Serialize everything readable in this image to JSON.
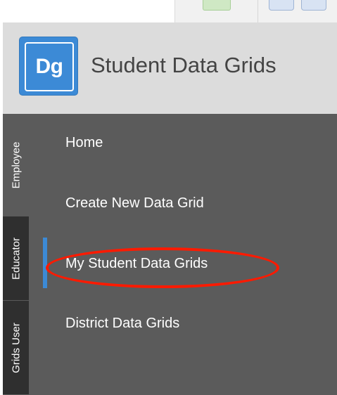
{
  "app": {
    "logo_text": "Dg",
    "title": "Student Data Grids"
  },
  "tabs": [
    {
      "label": "Employee"
    },
    {
      "label": "Educator",
      "active": true
    },
    {
      "label": "Grids User"
    }
  ],
  "menu": {
    "items": [
      {
        "label": "Home"
      },
      {
        "label": "Create New Data Grid"
      },
      {
        "label": "My Student Data Grids",
        "selected": true
      },
      {
        "label": "District Data Grids"
      }
    ]
  },
  "colors": {
    "brand_blue": "#3c8ad6",
    "sidebar_bg": "#5b5b5b",
    "header_bg": "#dcdcdc",
    "highlight_annotation": "#ff1a00"
  },
  "annotation": {
    "type": "red-ellipse",
    "target": "My Student Data Grids"
  }
}
